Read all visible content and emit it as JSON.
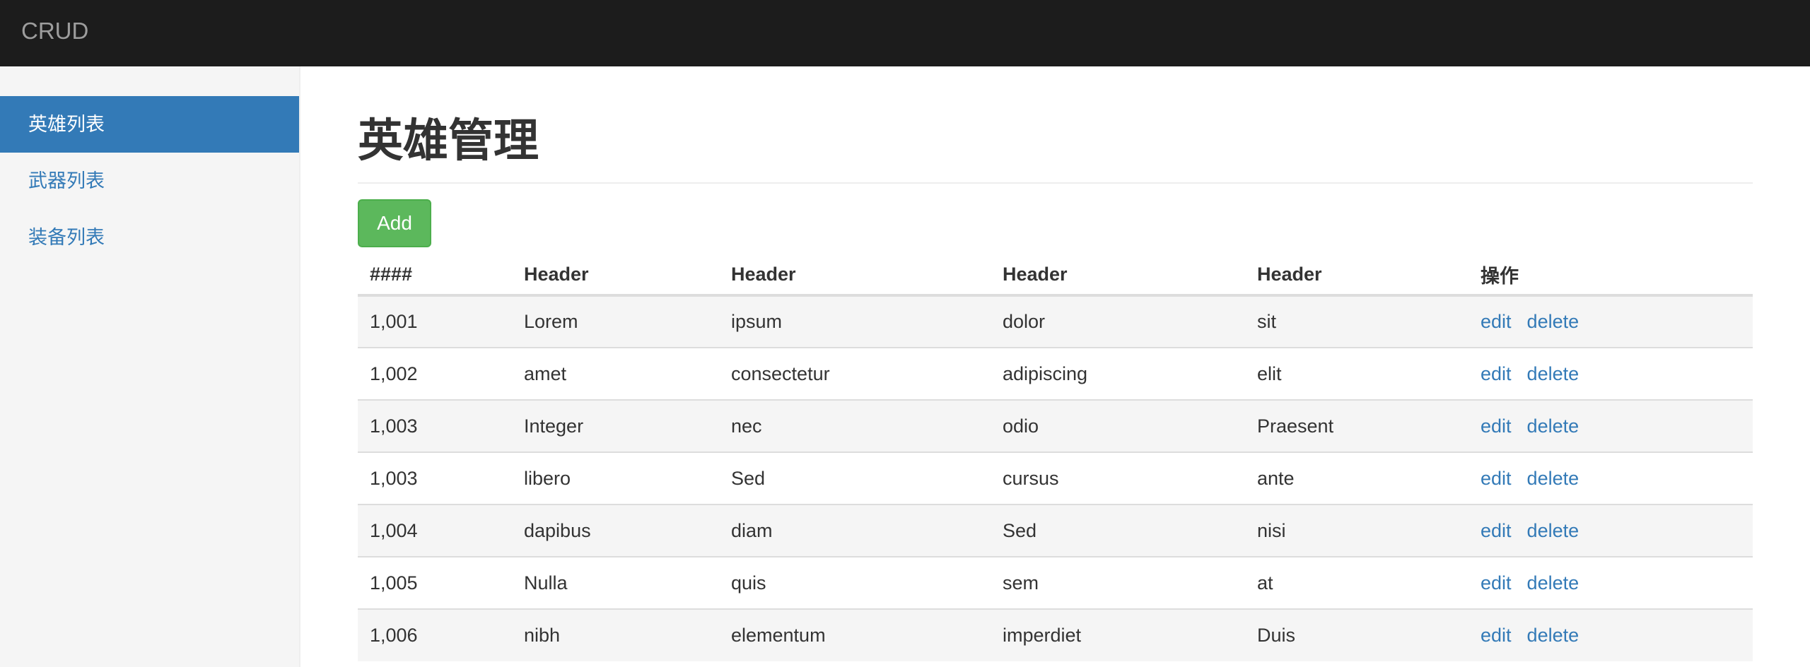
{
  "navbar": {
    "brand": "CRUD"
  },
  "sidebar": {
    "items": [
      {
        "label": "英雄列表",
        "active": true
      },
      {
        "label": "武器列表",
        "active": false
      },
      {
        "label": "装备列表",
        "active": false
      }
    ]
  },
  "main": {
    "title": "英雄管理",
    "add_label": "Add",
    "table": {
      "headers": [
        "####",
        "Header",
        "Header",
        "Header",
        "Header",
        "操作"
      ],
      "rows": [
        [
          "1,001",
          "Lorem",
          "ipsum",
          "dolor",
          "sit"
        ],
        [
          "1,002",
          "amet",
          "consectetur",
          "adipiscing",
          "elit"
        ],
        [
          "1,003",
          "Integer",
          "nec",
          "odio",
          "Praesent"
        ],
        [
          "1,003",
          "libero",
          "Sed",
          "cursus",
          "ante"
        ],
        [
          "1,004",
          "dapibus",
          "diam",
          "Sed",
          "nisi"
        ],
        [
          "1,005",
          "Nulla",
          "quis",
          "sem",
          "at"
        ],
        [
          "1,006",
          "nibh",
          "elementum",
          "imperdiet",
          "Duis"
        ]
      ],
      "edit_label": "edit",
      "delete_label": "delete"
    }
  },
  "colors": {
    "navbar_bg": "#1c1c1c",
    "primary": "#337ab7",
    "success": "#5cb85c",
    "sidebar_bg": "#f5f5f5"
  }
}
